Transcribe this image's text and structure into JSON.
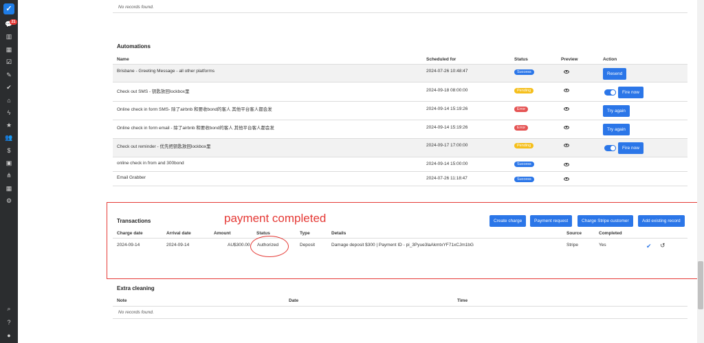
{
  "sidebar": {
    "badge": "21",
    "icons": [
      "chat-icon",
      "chart-icon",
      "calendar-icon",
      "calendar-check-icon",
      "brush-icon",
      "check-icon",
      "home-icon",
      "bolt-icon",
      "star-icon",
      "users-icon",
      "dollar-icon",
      "briefcase-icon",
      "share-icon",
      "grid-icon",
      "gear-icon",
      "search-icon",
      "help-icon",
      "user-icon"
    ]
  },
  "top_section": {
    "no_records": "No records found."
  },
  "automations": {
    "title": "Automations",
    "headers": {
      "name": "Name",
      "scheduled": "Scheduled for",
      "status": "Status",
      "preview": "Preview",
      "action": "Action"
    },
    "rows": [
      {
        "name": "Brisbane - Greeting Message - all other platforms",
        "scheduled": "2024-07-26 10:48:47",
        "status": "Success",
        "action": "Resend"
      },
      {
        "name": "Check out SMS - 钥匙放回lockbox里",
        "scheduled": "2024-09-18 08:00:00",
        "status": "Pending",
        "action": "Fire now"
      },
      {
        "name": "Online check in form SMS- 除了airbnb 和要收bond的客人 其他平台客人都会发",
        "scheduled": "2024-09-14 15:19:26",
        "status": "Error",
        "action": "Try again"
      },
      {
        "name": "Online check in form email - 除了airbnb 和要收bond的客人 其他平台客人都会发",
        "scheduled": "2024-09-14 15:19:26",
        "status": "Error",
        "action": "Try again"
      },
      {
        "name": "Check out reminder - 优先把钥匙放回lockbox里",
        "scheduled": "2024-09-17 17:00:00",
        "status": "Pending",
        "action": "Fire now"
      },
      {
        "name": "online check in from and 300bond",
        "scheduled": "2024-09-14 15:00:00",
        "status": "Success",
        "action": ""
      },
      {
        "name": "Email Grabber",
        "scheduled": "2024-07-26 11:18:47",
        "status": "Success",
        "action": ""
      }
    ]
  },
  "annotation": "payment completed",
  "transactions": {
    "title": "Transactions",
    "buttons": [
      "Create charge",
      "Payment request",
      "Charge Stripe customer",
      "Add existing record"
    ],
    "headers": {
      "charge_date": "Charge date",
      "arrival_date": "Arrival date",
      "amount": "Amount",
      "status": "Status",
      "type": "Type",
      "details": "Details",
      "source": "Source",
      "completed": "Completed"
    },
    "row": {
      "charge_date": "2024-09-14",
      "arrival_date": "2024-09-14",
      "amount": "AU$300.00",
      "status": "Authorized",
      "type": "Deposit",
      "details": "Damage deposit $300 | Payment ID - pi_3Pyue3laAkmtxYF71xCJm1bG",
      "source": "Stripe",
      "completed": "Yes"
    }
  },
  "extra_cleaning": {
    "title": "Extra cleaning",
    "headers": {
      "note": "Note",
      "date": "Date",
      "time": "Time"
    },
    "no_records": "No records found."
  },
  "colors": {
    "accent": "#2b76e8",
    "annotation": "#e53935",
    "sidebar": "#2b2d2f"
  }
}
